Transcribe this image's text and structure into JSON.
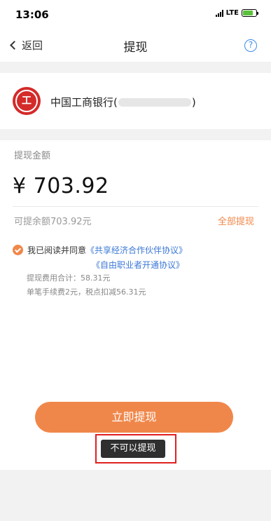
{
  "status_bar": {
    "time": "13:06",
    "network": "LTE"
  },
  "nav": {
    "back_label": "返回",
    "title": "提现",
    "help_icon": "?"
  },
  "bank": {
    "name": "中国工商银行",
    "account_open": "(",
    "account_close": ")"
  },
  "withdraw": {
    "amount_label": "提现金额",
    "amount_value": "¥ 703.92",
    "available_text": "可提余额703.92元",
    "withdraw_all_label": "全部提现",
    "agree_prefix": "我已阅读并同意",
    "agreement_link_1": "《共享经济合作伙伴协议》",
    "agreement_link_2": "《自由职业者开通协议》",
    "fee_total": "提现费用合计：58.31元",
    "fee_detail": "单笔手续费2元，税点扣减56.31元",
    "submit_label": "立即提现",
    "toast_text": "不可以提现"
  },
  "colors": {
    "accent": "#f0874a",
    "link": "#3b78d6",
    "bank_red": "#d42a2a",
    "highlight_border": "#e02020"
  }
}
